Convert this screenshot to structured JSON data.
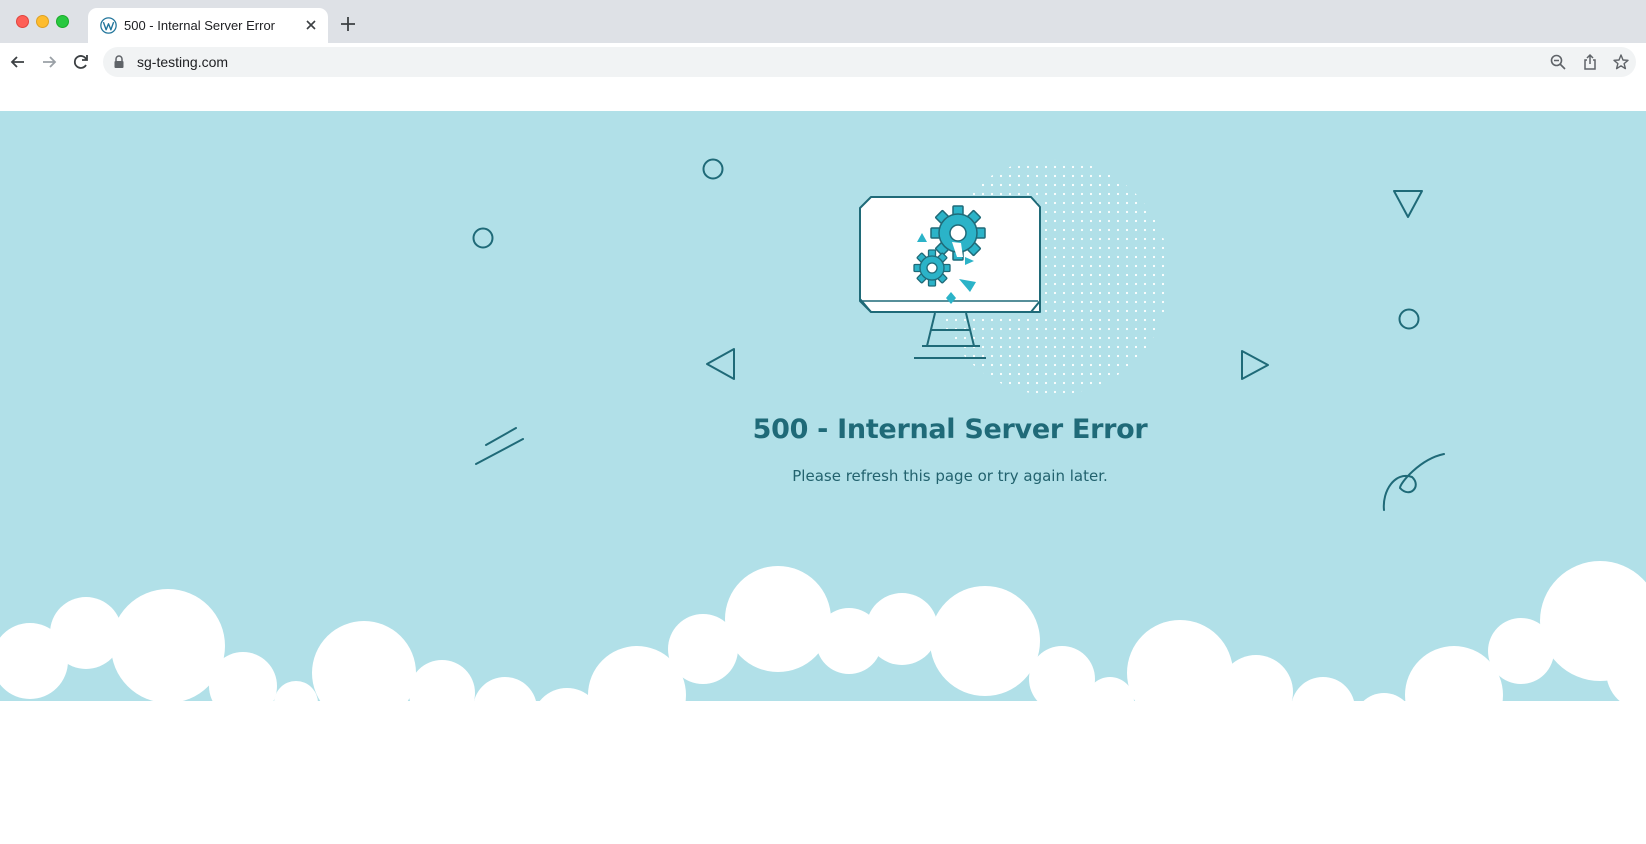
{
  "browser": {
    "tab": {
      "title": "500 - Internal Server Error",
      "favicon": "wordpress-icon"
    },
    "address_bar": {
      "url": "sg-testing.com"
    },
    "icons": {
      "back": "arrow-left-icon",
      "forward": "arrow-right-icon",
      "reload": "reload-icon",
      "lock": "lock-icon",
      "zoom": "zoom-out-icon",
      "share": "share-icon",
      "bookmark": "star-icon",
      "new_tab": "plus-icon",
      "close_tab": "close-icon"
    }
  },
  "page": {
    "title": "500 - Internal Server Error",
    "message": "Please refresh this page or try again later.",
    "illustration": "monitor-with-broken-gears-icon"
  },
  "colors": {
    "background": "#b1e0e8",
    "title": "#1f6a78",
    "accent": "#2bb3c8",
    "clouds": "#ffffff",
    "tabbar": "#dee1e6"
  }
}
